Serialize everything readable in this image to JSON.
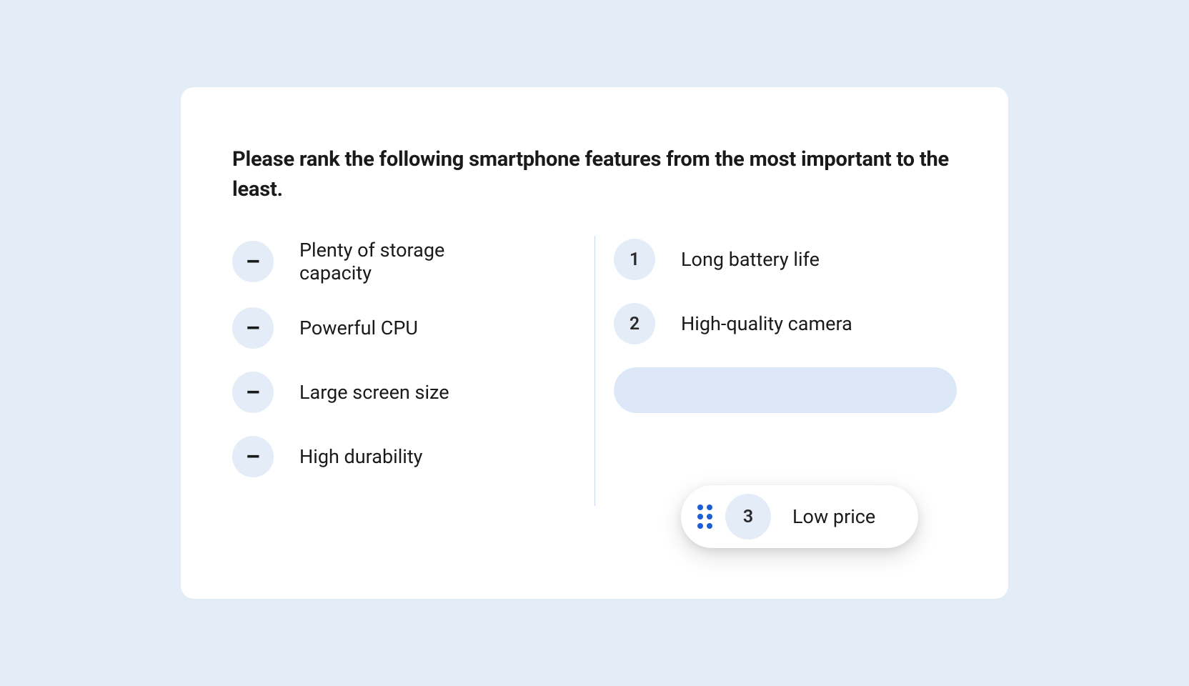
{
  "question": "Please rank the following smartphone features from the most important to the least.",
  "unranked": {
    "items": [
      {
        "badge": "–",
        "label": "Plenty of storage capacity"
      },
      {
        "badge": "–",
        "label": "Powerful CPU"
      },
      {
        "badge": "–",
        "label": "Large screen size"
      },
      {
        "badge": "–",
        "label": "High durability"
      }
    ]
  },
  "ranked": {
    "items": [
      {
        "badge": "1",
        "label": "Long battery life"
      },
      {
        "badge": "2",
        "label": "High-quality camera"
      }
    ]
  },
  "dragging": {
    "badge": "3",
    "label": "Low price"
  }
}
